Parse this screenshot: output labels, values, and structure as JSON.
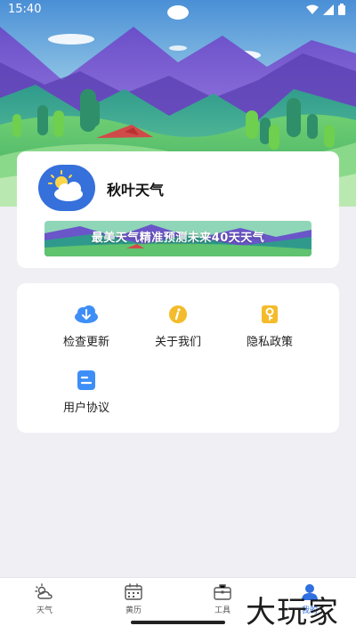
{
  "status_bar": {
    "time": "15:40"
  },
  "app": {
    "name": "秋叶天气",
    "banner_text": "最美天气精准预测未来40天天气"
  },
  "menu": {
    "items": [
      {
        "label": "检查更新",
        "icon": "cloud-download-icon"
      },
      {
        "label": "关于我们",
        "icon": "info-icon"
      },
      {
        "label": "隐私政策",
        "icon": "key-icon"
      },
      {
        "label": "用户协议",
        "icon": "document-icon"
      }
    ]
  },
  "bottom_nav": {
    "tabs": [
      {
        "label": "天气",
        "icon": "weather-icon"
      },
      {
        "label": "黄历",
        "icon": "calendar-icon"
      },
      {
        "label": "工具",
        "icon": "toolbox-icon"
      },
      {
        "label": "我的",
        "icon": "user-icon"
      }
    ],
    "active_tab": "我的"
  },
  "watermark": "大玩家",
  "colors": {
    "accent": "#2f6fe0",
    "logo_bg": "#3670db",
    "page_bg": "#efeff4",
    "icon_blue": "#3e8ef7",
    "icon_yellow": "#f4bb2a"
  }
}
